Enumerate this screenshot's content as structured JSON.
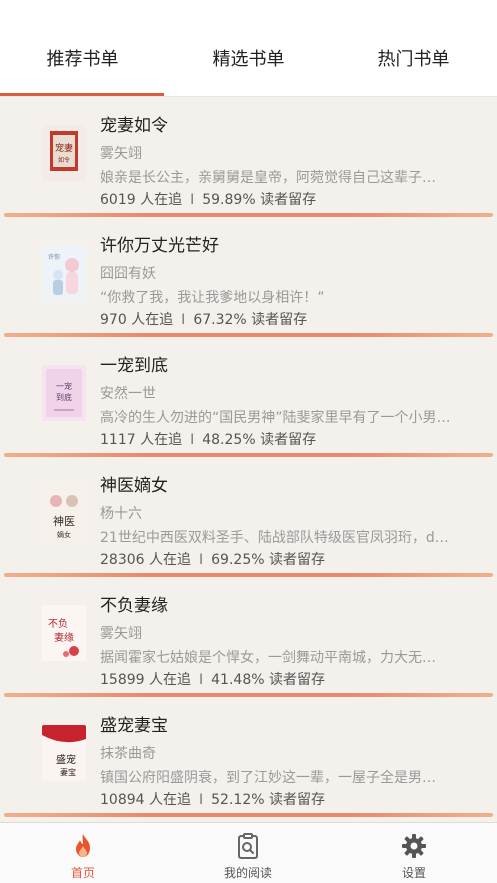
{
  "tabs": [
    {
      "label": "推荐书单",
      "active": true
    },
    {
      "label": "精选书单",
      "active": false
    },
    {
      "label": "热门书单",
      "active": false
    }
  ],
  "colors": {
    "accent": "#e05a3c",
    "list_bg": "#f4f0ec",
    "stripe": "#e7896a"
  },
  "books": [
    {
      "title": "宠妻如令",
      "author": "雾矢翊",
      "desc": "娘亲是长公主，亲舅舅是皇帝，阿菀觉得自己这辈子…",
      "followers": "6019 人在追",
      "retention": "59.89% 读者留存",
      "cover_icon": "book-cover-1"
    },
    {
      "title": "许你万丈光芒好",
      "author": "囧囧有妖",
      "desc": "“你救了我，我让我爹地以身相许！”",
      "followers": "970 人在追",
      "retention": "67.32% 读者留存",
      "cover_icon": "book-cover-2"
    },
    {
      "title": "一宠到底",
      "author": "安然一世",
      "desc": "高冷的生人勿进的“国民男神”陆斐家里早有了一个小男…",
      "followers": "1117 人在追",
      "retention": "48.25% 读者留存",
      "cover_icon": "book-cover-3"
    },
    {
      "title": "神医嫡女",
      "author": "杨十六",
      "desc": "21世纪中西医双料圣手、陆战部队特级医官凤羽珩，d…",
      "followers": "28306 人在追",
      "retention": "69.25% 读者留存",
      "cover_icon": "book-cover-4"
    },
    {
      "title": "不负妻缘",
      "author": "雾矢翊",
      "desc": "据闻霍家七姑娘是个悍女，一剑舞动平南城，力大无…",
      "followers": "15899 人在追",
      "retention": "41.48% 读者留存",
      "cover_icon": "book-cover-5"
    },
    {
      "title": "盛宠妻宝",
      "author": "抹茶曲奇",
      "desc": "镇国公府阳盛阴衰，到了江妙这一辈，一屋子全是男…",
      "followers": "10894 人在追",
      "retention": "52.12% 读者留存",
      "cover_icon": "book-cover-6"
    }
  ],
  "stats_separator": "I",
  "tabbar": [
    {
      "label": "首页",
      "icon": "flame-icon",
      "active": true
    },
    {
      "label": "我的阅读",
      "icon": "clipboard-search-icon",
      "active": false
    },
    {
      "label": "设置",
      "icon": "gear-icon",
      "active": false
    }
  ]
}
